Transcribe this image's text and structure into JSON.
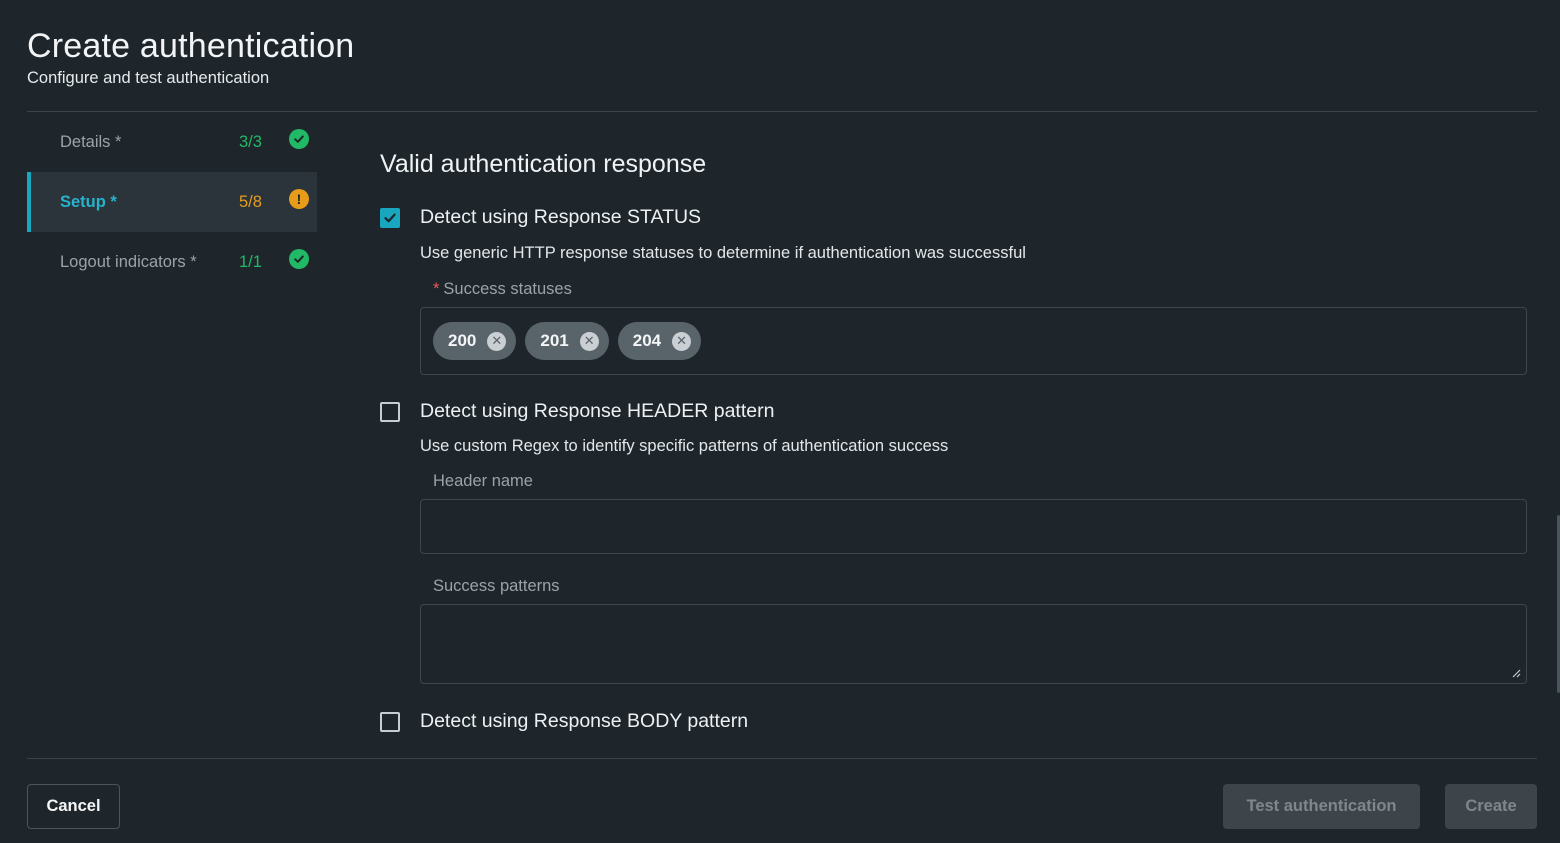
{
  "header": {
    "title": "Create authentication",
    "subtitle": "Configure and test authentication"
  },
  "sidebar": {
    "steps": [
      {
        "label": "Details *",
        "count": "3/3",
        "status": "complete",
        "icon": "check-circle-icon"
      },
      {
        "label": "Setup *",
        "count": "5/8",
        "status": "warning",
        "icon": "exclamation-circle-icon",
        "icon_glyph": "!"
      },
      {
        "label": "Logout indicators *",
        "count": "1/1",
        "status": "complete",
        "icon": "check-circle-icon"
      }
    ]
  },
  "main": {
    "section_title": "Valid authentication response",
    "status_option": {
      "label": "Detect using Response STATUS",
      "checked": true,
      "description": "Use generic HTTP response statuses to determine if authentication was successful",
      "field_label": "Success statuses",
      "required_mark": "*",
      "tags": [
        "200",
        "201",
        "204"
      ]
    },
    "header_option": {
      "label": "Detect using Response HEADER pattern",
      "checked": false,
      "description": "Use custom Regex to identify specific patterns of authentication success",
      "header_name_label": "Header name",
      "header_name_value": "",
      "success_patterns_label": "Success patterns",
      "success_patterns_value": ""
    },
    "body_option": {
      "label": "Detect using Response BODY pattern",
      "checked": false
    }
  },
  "footer": {
    "cancel_label": "Cancel",
    "test_label": "Test authentication",
    "create_label": "Create"
  },
  "colors": {
    "background": "#1f262b",
    "accent": "#19a7c0",
    "success": "#21b866",
    "warning": "#e89c1a"
  }
}
